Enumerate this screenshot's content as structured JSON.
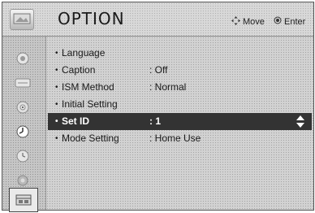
{
  "header": {
    "title": "OPTION",
    "hints": [
      {
        "icon": "move-arrows-icon",
        "label": "Move"
      },
      {
        "icon": "enter-dot-icon",
        "label": "Enter"
      }
    ]
  },
  "sidebar": {
    "items": [
      {
        "icon": "picture-icon"
      },
      {
        "icon": "audio-icon"
      },
      {
        "icon": "channel-icon"
      },
      {
        "icon": "disc-icon"
      },
      {
        "icon": "clock-icon"
      },
      {
        "icon": "lock-icon"
      },
      {
        "icon": "option-icon",
        "active": true
      }
    ]
  },
  "menu": {
    "items": [
      {
        "bullet": "•",
        "label": "Language",
        "value": ""
      },
      {
        "bullet": "•",
        "label": "Caption",
        "value": ": Off"
      },
      {
        "bullet": "•",
        "label": "ISM Method",
        "value": ": Normal"
      },
      {
        "bullet": "•",
        "label": "Initial Setting",
        "value": ""
      },
      {
        "bullet": "•",
        "label": "Set ID",
        "value": ": 1",
        "selected": true
      },
      {
        "bullet": "•",
        "label": "Mode Setting",
        "value": ": Home Use"
      }
    ]
  },
  "colors": {
    "selected_bg": "#333333",
    "selected_text": "#ffffff",
    "background": "#d2d2d2"
  }
}
